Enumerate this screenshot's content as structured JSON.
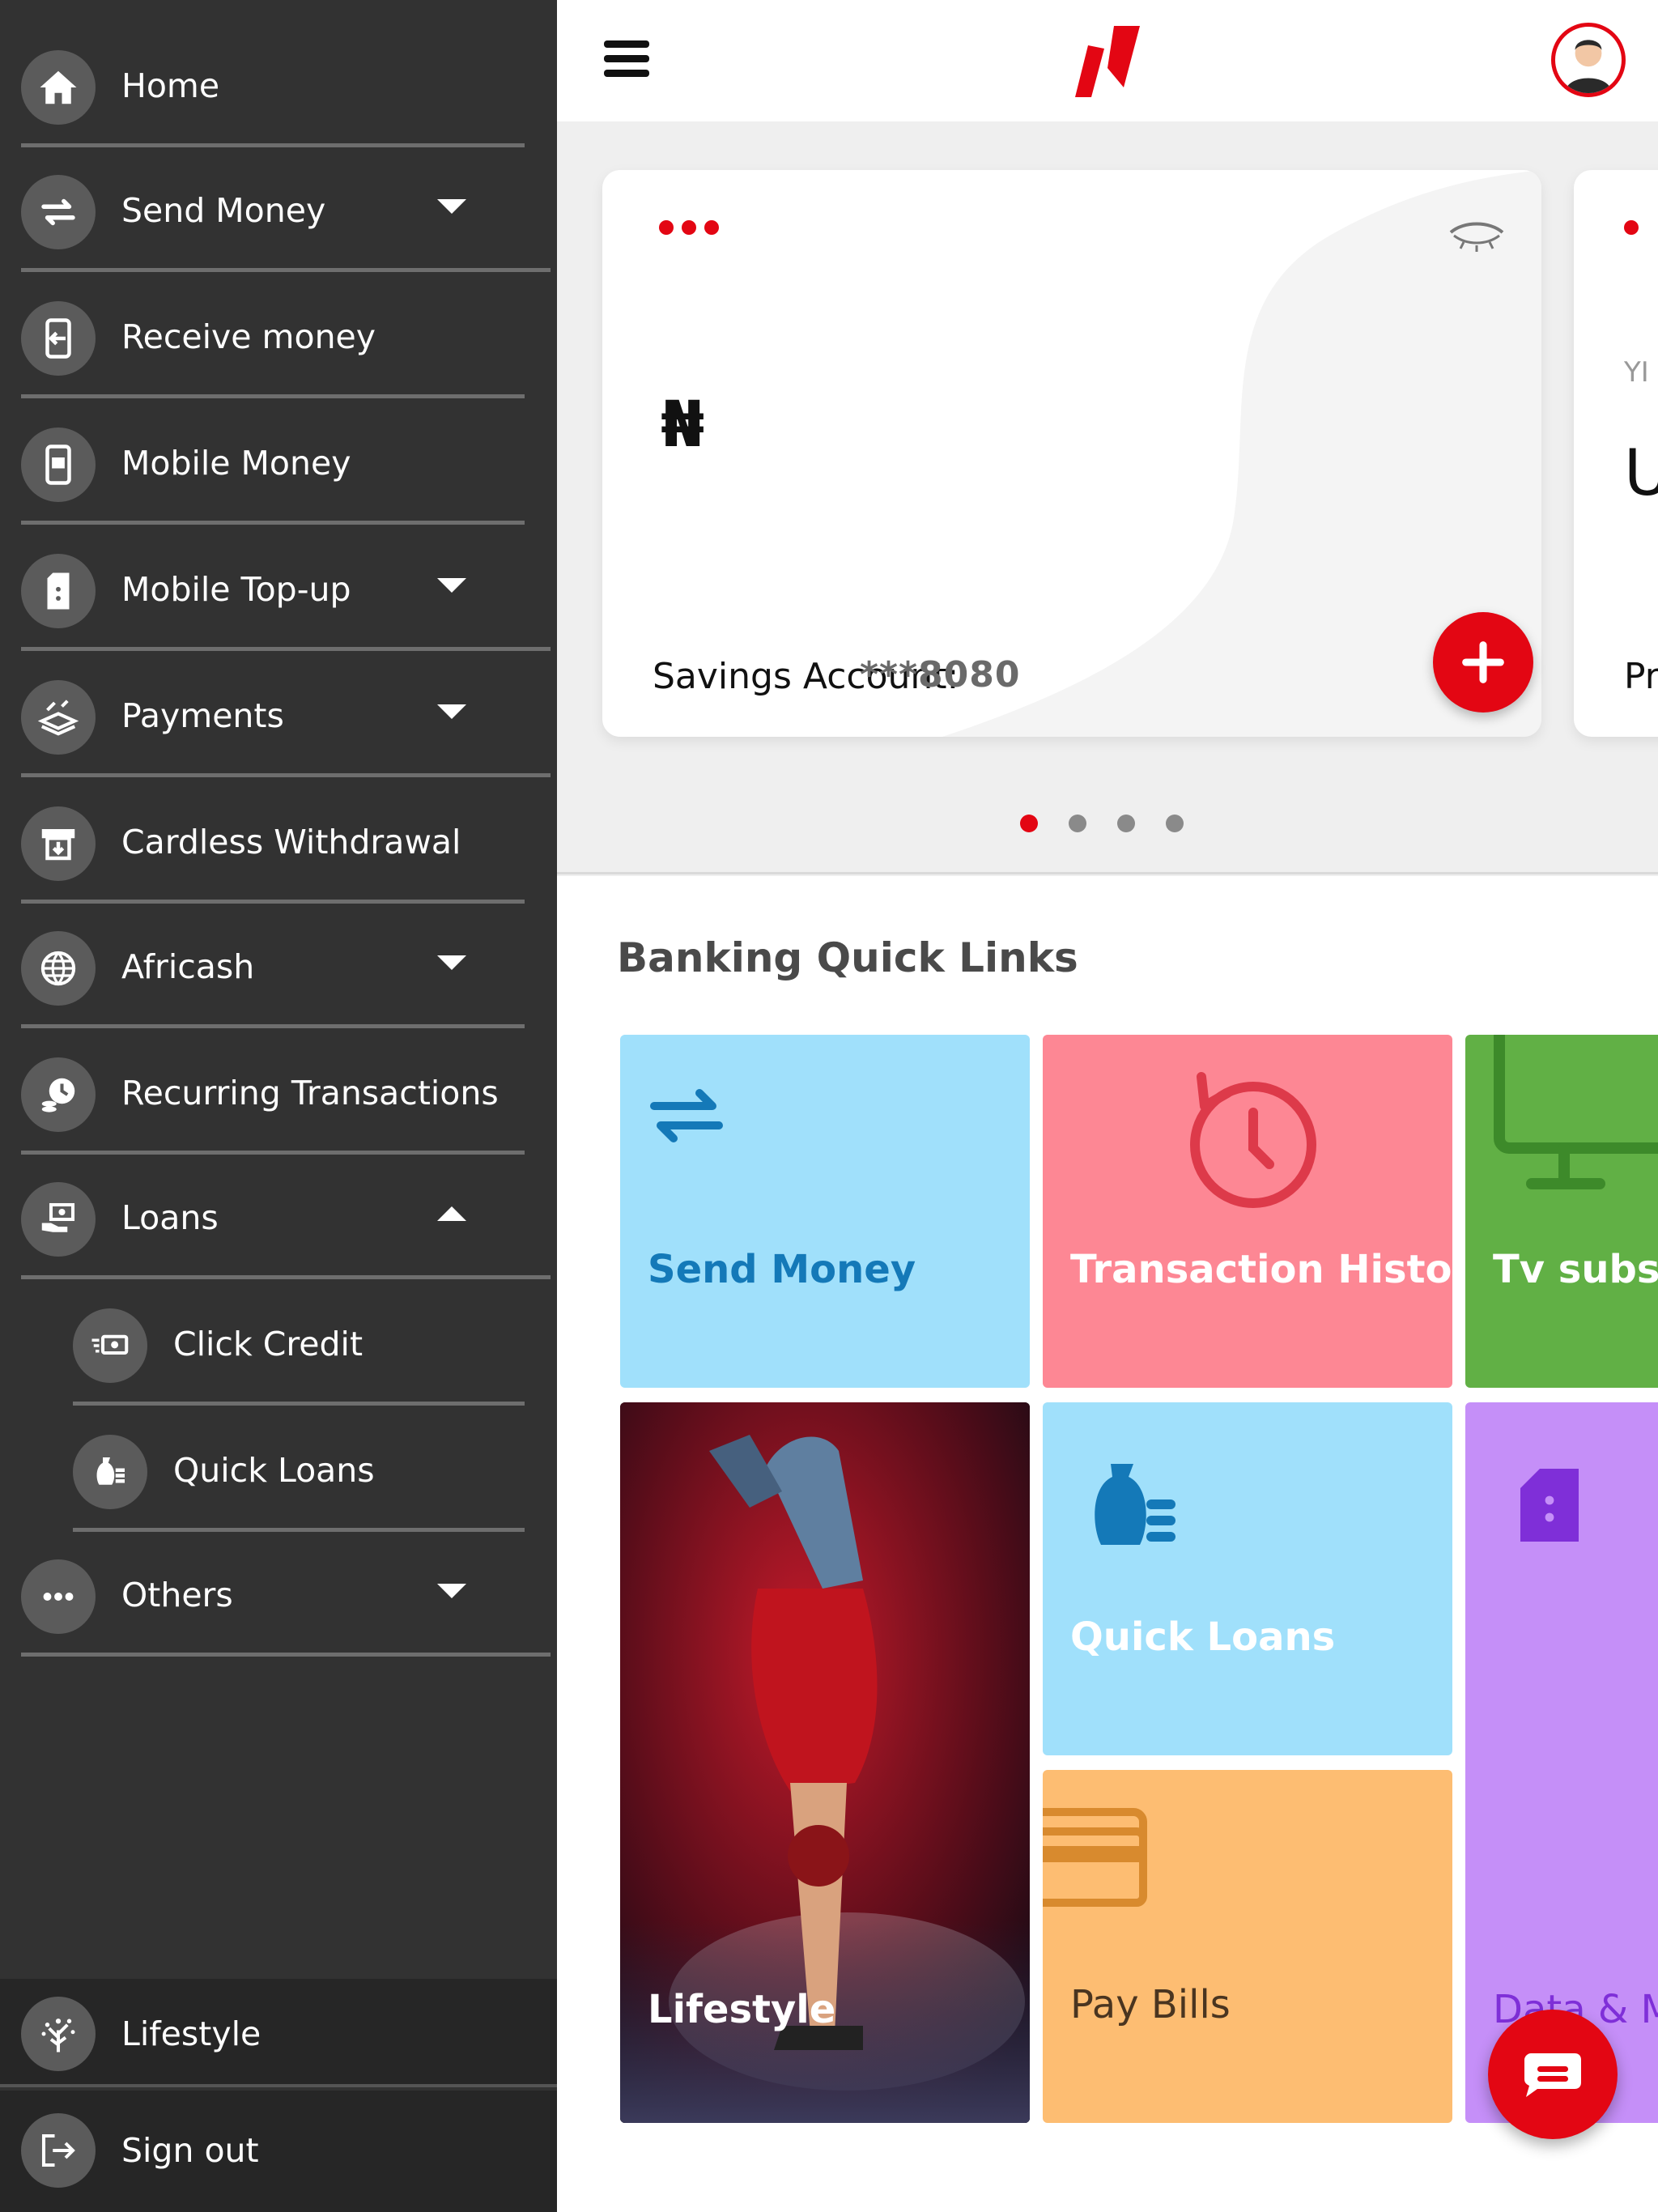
{
  "sidebar": {
    "items": [
      {
        "label": "Home",
        "icon": "home-icon"
      },
      {
        "label": "Send Money",
        "icon": "transfer-arrows-icon"
      },
      {
        "label": "Receive money",
        "icon": "phone-receive-icon"
      },
      {
        "label": "Mobile Money",
        "icon": "mobile-wallet-icon"
      },
      {
        "label": "Mobile Top-up",
        "icon": "sim-card-icon"
      },
      {
        "label": "Payments",
        "icon": "cash-stack-icon"
      },
      {
        "label": "Cardless Withdrawal",
        "icon": "atm-icon"
      },
      {
        "label": "Africash",
        "icon": "globe-icon"
      },
      {
        "label": "Recurring Transactions",
        "icon": "clock-coins-icon"
      },
      {
        "label": "Loans",
        "icon": "hand-cash-icon"
      },
      {
        "label": "Click Credit",
        "icon": "flying-cash-icon"
      },
      {
        "label": "Quick Loans",
        "icon": "money-bag-icon"
      },
      {
        "label": "Others",
        "icon": "more-dots-icon"
      }
    ],
    "lifestyle_label": "Lifestyle",
    "signout_label": "Sign out"
  },
  "card": {
    "currency_symbol": "₦",
    "account_label": "Savings Account:",
    "account_number": "***8080"
  },
  "card2": {
    "line1": "YI",
    "line2": "U",
    "line3": "Pr"
  },
  "quick_links": {
    "title": "Banking Quick Links",
    "tiles": [
      {
        "label": "Send Money",
        "color": "#a0e0fb"
      },
      {
        "label": "Transaction History",
        "color": "#fd8794"
      },
      {
        "label": "Tv subscr",
        "color": "#61b045"
      },
      {
        "label": "Lifestyle",
        "color": "#1a1a1a"
      },
      {
        "label": "Quick Loans",
        "color": "#a0e0fb"
      },
      {
        "label": "Pay Bills",
        "color": "#fdbd72"
      },
      {
        "label": "Data & M",
        "color": "#c58ff8"
      }
    ]
  },
  "colors": {
    "brand_red": "#e30613",
    "sidebar_bg": "#323232"
  }
}
